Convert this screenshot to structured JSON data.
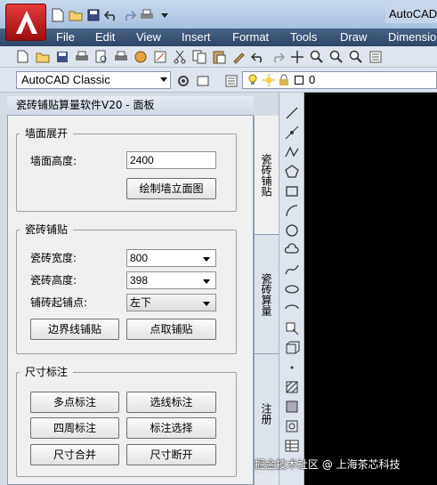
{
  "window": {
    "title": "AutoCAD"
  },
  "menu": [
    "File",
    "Edit",
    "View",
    "Insert",
    "Format",
    "Tools",
    "Draw",
    "Dimensio"
  ],
  "toolbar": {
    "workspace": "AutoCAD Classic",
    "layer_value": "0"
  },
  "panel": {
    "title": "瓷砖铺贴算量软件V20 - 面板",
    "wall": {
      "group_label": "墙面展开",
      "height_label": "墙面高度:",
      "height_value": "2400",
      "draw_button": "绘制墙立面图"
    },
    "tile": {
      "group_label": "瓷砖铺贴",
      "width_label": "瓷砖宽度:",
      "width_value": "800",
      "height_label": "瓷砖高度:",
      "height_value": "398",
      "start_label": "铺砖起铺点:",
      "start_value": "左下",
      "boundary_button": "边界线铺贴",
      "point_button": "点取铺贴"
    },
    "dimension": {
      "group_label": "尺寸标注",
      "buttons": [
        "多点标注",
        "选线标注",
        "四周标注",
        "标注选择",
        "尺寸合并",
        "尺寸断开"
      ]
    },
    "tabs": [
      "瓷砖铺贴",
      "瓷砖算量",
      "注册"
    ]
  },
  "watermark": "掘金技术社区 @ 上海茶芯科技",
  "colors": {
    "menubar": "#2e4566",
    "logo": "#c8201e",
    "drawing_bg": "#000000"
  }
}
